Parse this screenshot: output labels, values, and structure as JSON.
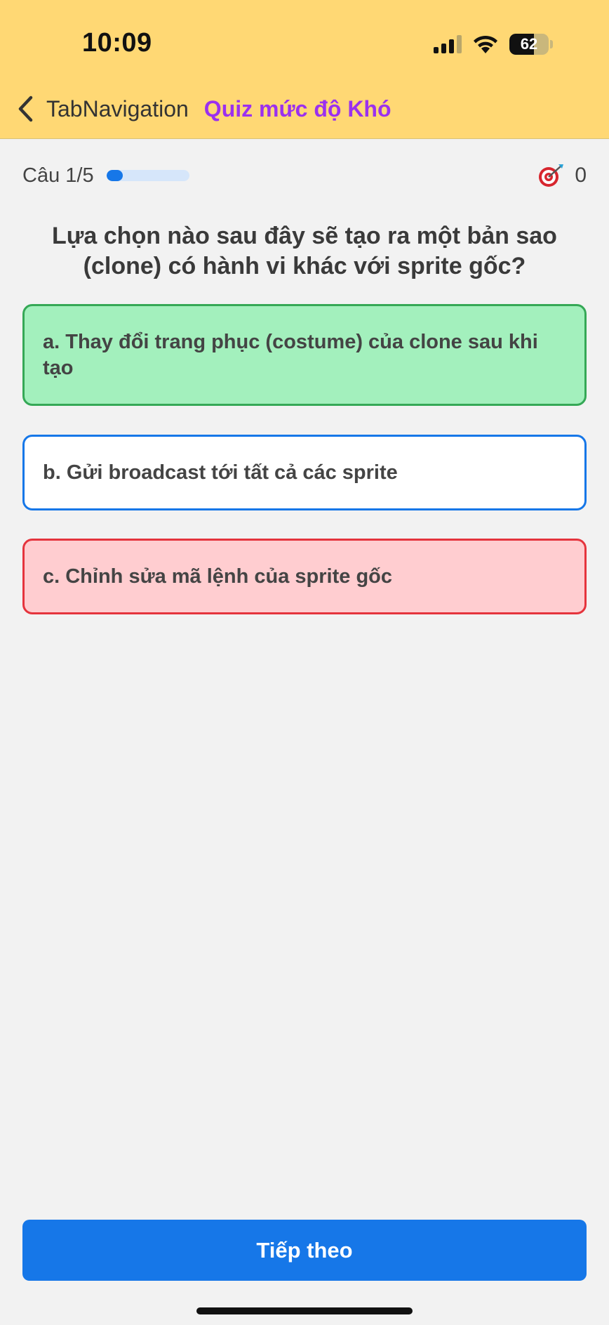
{
  "status_bar": {
    "time": "10:09",
    "battery_level": "62",
    "battery_fraction": 0.62
  },
  "nav": {
    "back_label": "TabNavigation",
    "title": "Quiz mức độ Khó",
    "title_color": "#9b30ef"
  },
  "progress": {
    "counter": "Câu 1/5",
    "fraction": 0.2,
    "color": "#1677e8"
  },
  "score": {
    "icon": "target-icon",
    "value": "0"
  },
  "question": "Lựa chọn nào sau đây sẽ tạo ra một bản sao (clone) có hành vi khác với sprite gốc?",
  "options": [
    {
      "label": "a. Thay đổi trang phục (costume) của clone sau khi tạo",
      "state": "correct",
      "color": "#35a856"
    },
    {
      "label": "b. Gửi broadcast tới tất cả các sprite",
      "state": "default",
      "color": "#1677e8"
    },
    {
      "label": "c. Chỉnh sửa mã lệnh của sprite gốc",
      "state": "wrong",
      "color": "#e5343d"
    }
  ],
  "next_button": "Tiếp theo",
  "colors": {
    "header_bg": "#ffd874",
    "accent": "#1677e8",
    "correct_bg": "#a3f0bd",
    "wrong_bg": "#ffcdd0"
  }
}
